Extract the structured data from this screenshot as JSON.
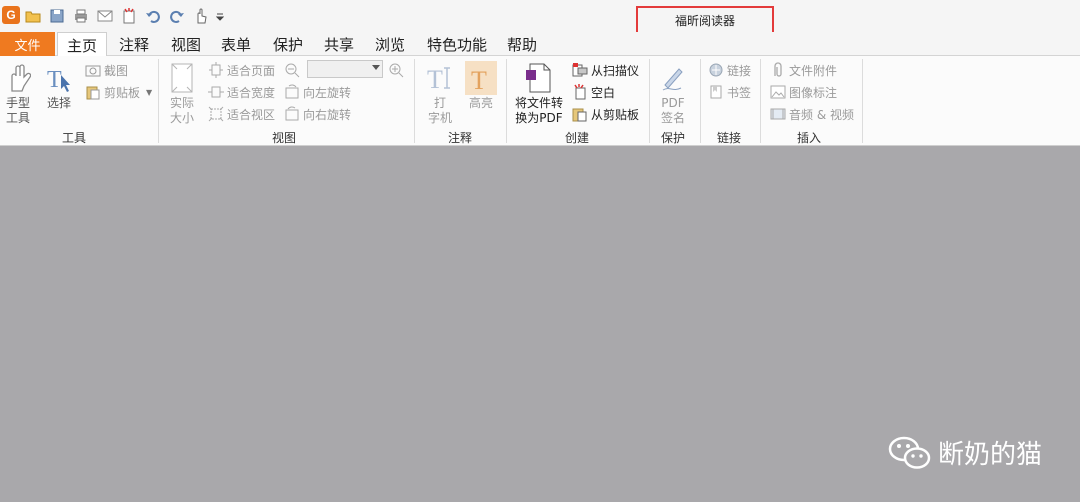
{
  "window": {
    "title": "福昕阅读器",
    "brand_color": "#ef7a20",
    "workspace_color": "#a9a8ab"
  },
  "quick_access": {
    "icons": [
      "app-logo-icon",
      "open-icon",
      "save-icon",
      "print-icon",
      "email-icon",
      "new-icon",
      "undo-icon",
      "redo-icon",
      "hand-icon",
      "customize-icon"
    ]
  },
  "menu": {
    "file": "文件",
    "tabs": [
      "主页",
      "注释",
      "视图",
      "表单",
      "保护",
      "共享",
      "浏览",
      "特色功能",
      "帮助"
    ]
  },
  "ribbon": {
    "tools": {
      "label": "工具",
      "hand": "手型\n工具",
      "select": "选择",
      "screenshot": "截图",
      "clipboard": "剪贴板"
    },
    "view": {
      "label": "视图",
      "actual_size": "实际\n大小",
      "fit_page": "适合页面",
      "fit_width": "适合宽度",
      "fit_visible": "适合视区",
      "rotate_left": "向左旋转",
      "rotate_right": "向右旋转",
      "zoom_value": ""
    },
    "comment": {
      "label": "注释",
      "typewriter": "打\n字机",
      "highlight": "高亮"
    },
    "create": {
      "label": "创建",
      "convert": "将文件转\n换为PDF",
      "from_scanner": "从扫描仪",
      "blank": "空白",
      "from_clipboard": "从剪贴板"
    },
    "protect": {
      "label": "保护",
      "pdf_sign": "PDF\n签名"
    },
    "links": {
      "label": "链接",
      "link": "链接",
      "bookmark": "书签"
    },
    "insert": {
      "label": "插入",
      "file_attachment": "文件附件",
      "image_annotation": "图像标注",
      "audio_video": "音频 & 视频"
    }
  },
  "watermark": {
    "text": "断奶的猫"
  }
}
